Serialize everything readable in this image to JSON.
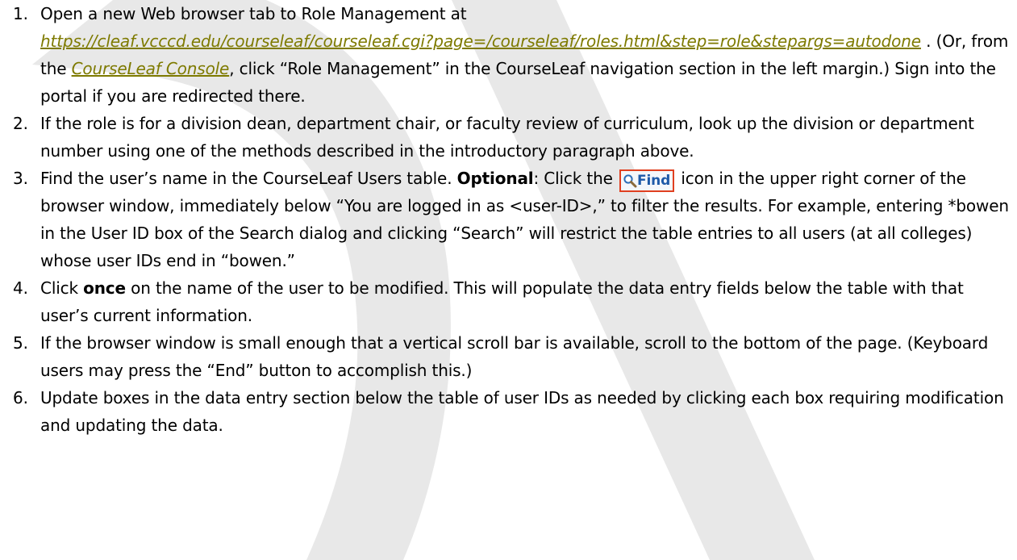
{
  "steps": [
    {
      "number": "1.",
      "t1": "Open a new Web browser tab to Role Management at",
      "url": "https://cleaf.vcccd.edu/courseleaf/courseleaf.cgi?page=/courseleaf/roles.html&step=role&stepargs=autodone",
      "t2": " . (Or, from the ",
      "console_link": "CourseLeaf Console",
      "t3": ", click “Role Management” in the CourseLeaf navigation section in the left margin.) Sign into the portal if you are redirected there."
    },
    {
      "number": "2.",
      "text": "If the role is for a division dean, department chair, or faculty review of curriculum, look up the division or department number using one of the methods described in the introductory paragraph above."
    },
    {
      "number": "3.",
      "t1": "Find the user’s name in the CourseLeaf Users table. ",
      "bold": "Optional",
      "t2": ": Click the ",
      "find_label": "Find",
      "t3": " icon in the upper right corner of the browser window, immediately below “You are logged in as <user-ID>,” to filter the results. For example, entering *bowen in the User ID box of the Search dialog and clicking “Search” will restrict the table entries to all users (at all colleges) whose user IDs end in “bowen.”"
    },
    {
      "number": "4.",
      "t1": "Click ",
      "bold": "once",
      "t2": " on the name of the user to be modified. This will populate the data entry fields below the table with that user’s current information."
    },
    {
      "number": "5.",
      "text": "If the browser window is small enough that a vertical scroll bar is available, scroll to the bottom of the page. (Keyboard users may press the “End” button to accomplish this.)"
    },
    {
      "number": "6.",
      "text": "Update boxes in the data entry section below the table of user IDs as needed by clicking each box requiring modification and updating the data."
    }
  ],
  "icons": {
    "find_button": "magnifier-icon"
  },
  "colors": {
    "link": "#7e7a00",
    "watermark": "#d9d9d9",
    "find_border": "#e04020",
    "find_text": "#1e5aa8"
  }
}
